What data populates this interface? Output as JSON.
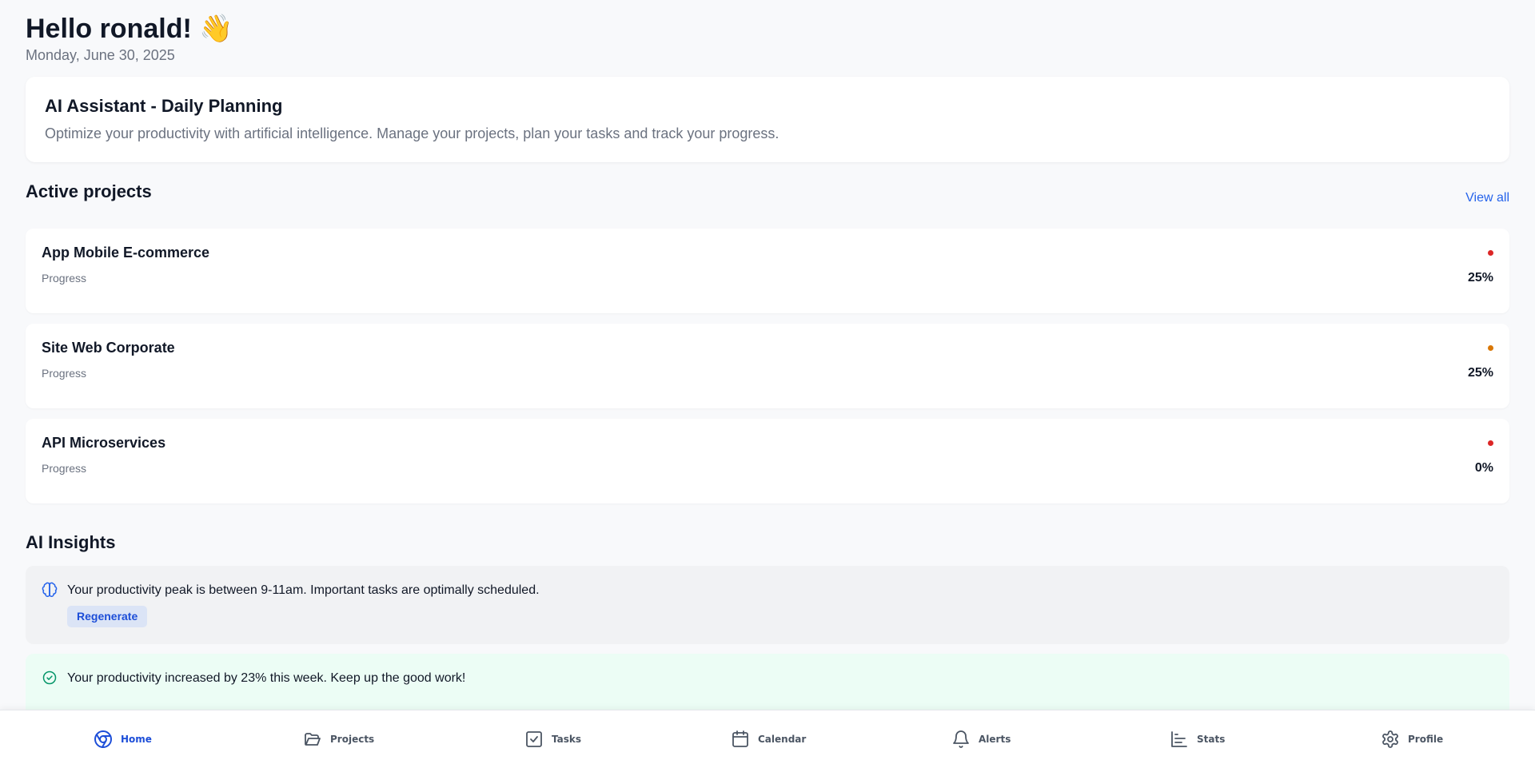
{
  "header": {
    "greeting": "Hello ronald! 👋",
    "date": "Monday, June 30, 2025"
  },
  "assistant": {
    "title": "AI Assistant - Daily Planning",
    "description": "Optimize your productivity with artificial intelligence. Manage your projects, plan your tasks and track your progress."
  },
  "projects": {
    "section_title": "Active projects",
    "view_all_label": "View all",
    "items": [
      {
        "name": "App Mobile E-commerce",
        "progress_label": "Progress",
        "progress": "25%",
        "status_color": "#dc2626"
      },
      {
        "name": "Site Web Corporate",
        "progress_label": "Progress",
        "progress": "25%",
        "status_color": "#d97706"
      },
      {
        "name": "API Microservices",
        "progress_label": "Progress",
        "progress": "0%",
        "status_color": "#dc2626"
      }
    ]
  },
  "insights": {
    "section_title": "AI Insights",
    "items": [
      {
        "icon": "brain-icon",
        "text": "Your productivity peak is between 9-11am. Important tasks are optimally scheduled.",
        "action_label": "Regenerate"
      },
      {
        "icon": "check-circle-icon",
        "text": "Your productivity increased by 23% this week. Keep up the good work!"
      }
    ]
  },
  "nav": {
    "active": "Home",
    "items": [
      {
        "label": "Home",
        "icon": "home-icon"
      },
      {
        "label": "Projects",
        "icon": "folder-icon"
      },
      {
        "label": "Tasks",
        "icon": "task-check-icon"
      },
      {
        "label": "Calendar",
        "icon": "calendar-icon"
      },
      {
        "label": "Alerts",
        "icon": "bell-icon"
      },
      {
        "label": "Stats",
        "icon": "bar-chart-icon"
      },
      {
        "label": "Profile",
        "icon": "gear-icon"
      }
    ]
  },
  "colors": {
    "accent": "#2563eb",
    "background": "#f8f9fb",
    "insight_neutral_bg": "#f1f2f4",
    "insight_success_bg": "#ecfdf5",
    "success": "#059669"
  }
}
